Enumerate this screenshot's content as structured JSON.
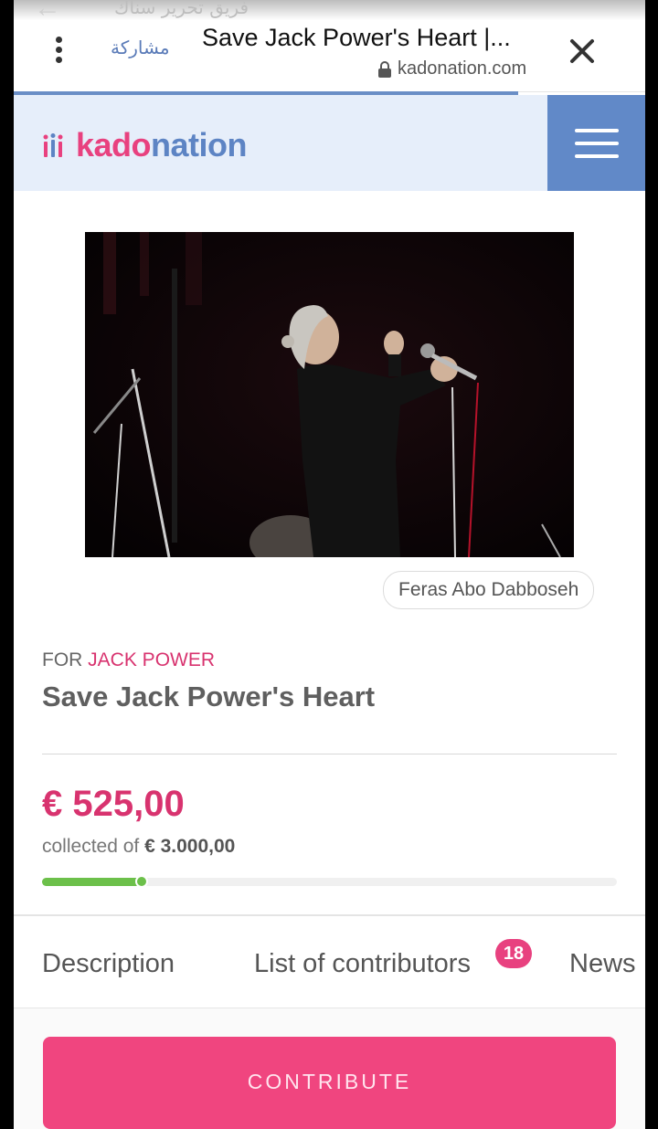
{
  "browser": {
    "arabic_header": "فريق تحرير سناك",
    "share_label": "مشاركة",
    "page_title": "Save Jack Power's Heart |...",
    "domain": "kadonation.com"
  },
  "site": {
    "logo_part1": "kado",
    "logo_part2": "nation"
  },
  "photo": {
    "credit": "Feras Abo Dabboseh"
  },
  "campaign": {
    "for_prefix": "FOR",
    "for_name": "JACK POWER",
    "title": "Save Jack Power's Heart",
    "amount": "€ 525,00",
    "collected_of": "collected of",
    "goal": "€ 3.000,00",
    "progress_fraction": 0.175
  },
  "tabs": {
    "description": "Description",
    "contributors": "List of contributors",
    "contributors_count": "18",
    "news": "News"
  },
  "actions": {
    "contribute": "CONTRIBUTE"
  },
  "colors": {
    "brand_pink": "#e8417f",
    "brand_blue": "#5d84c4",
    "progress_green": "#6cc04a"
  }
}
